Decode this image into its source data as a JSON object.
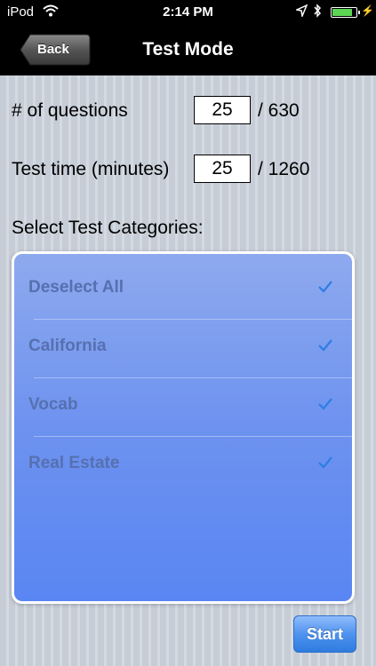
{
  "status_bar": {
    "carrier": "iPod",
    "time": "2:14 PM",
    "icons": [
      "wifi-icon",
      "location-arrow-icon",
      "bluetooth-icon",
      "battery-icon",
      "charging-bolt-icon"
    ],
    "battery_level": 0.9,
    "battery_color": "#5bd552"
  },
  "nav": {
    "back_label": "Back",
    "title": "Test Mode"
  },
  "questions": {
    "label": "# of questions",
    "value": "25",
    "total": "/ 630"
  },
  "test_time": {
    "label": "Test time (minutes)",
    "value": "25",
    "total": "/ 1260"
  },
  "categories": {
    "heading": "Select Test Categories:",
    "items": [
      {
        "label": "Deselect All",
        "checked": true
      },
      {
        "label": "California",
        "checked": true
      },
      {
        "label": "Vocab",
        "checked": true
      },
      {
        "label": "Real Estate",
        "checked": true
      }
    ]
  },
  "start_label": "Start",
  "colors": {
    "accent": "#2e7be0",
    "checkmark": "#2d7de6",
    "panel": "#6d92ef"
  }
}
